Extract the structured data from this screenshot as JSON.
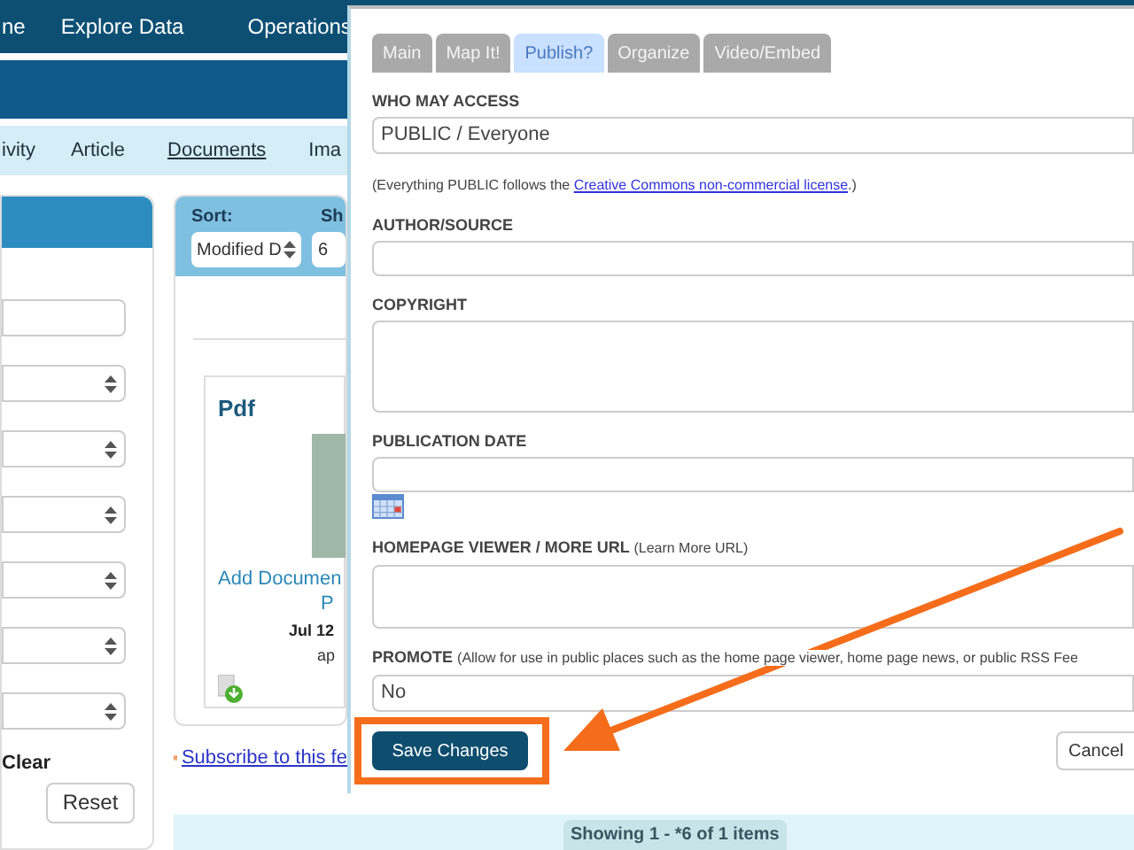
{
  "top_nav": {
    "items": [
      "ne",
      "Explore Data",
      "Operations"
    ]
  },
  "sub_nav": {
    "items": [
      {
        "label": "ivity",
        "selected": false
      },
      {
        "label": "Article",
        "selected": false
      },
      {
        "label": "Documents",
        "selected": true
      },
      {
        "label": "Ima",
        "selected": false
      }
    ]
  },
  "filter_panel": {
    "fields": [
      {
        "kind": "text"
      },
      {
        "kind": "select"
      },
      {
        "kind": "select"
      },
      {
        "kind": "select"
      },
      {
        "kind": "select"
      },
      {
        "kind": "select"
      },
      {
        "kind": "select"
      }
    ],
    "clear_label": "Clear",
    "reset_button": "Reset"
  },
  "results": {
    "sort_label": "Sort:",
    "show_label": "Sh",
    "sort_value": "Modified D",
    "show_value": "6",
    "card": {
      "title": "Pdf",
      "link": "Add Documen",
      "link_line_2": "P",
      "date": "Jul 12",
      "line_4": "ap"
    },
    "subscribe_link": "Subscribe to this fe",
    "showing": "Showing 1 - *6 of 1 items"
  },
  "dialog": {
    "tabs": [
      {
        "label": "Main",
        "selected": false
      },
      {
        "label": "Map It!",
        "selected": false
      },
      {
        "label": "Publish?",
        "selected": true
      },
      {
        "label": "Organize",
        "selected": false
      },
      {
        "label": "Video/Embed",
        "selected": false
      }
    ],
    "fields": [
      {
        "kind": "select",
        "label": "WHO MAY ACCESS",
        "value": "PUBLIC / Everyone"
      },
      {
        "kind": "note",
        "before": "(Everything PUBLIC follows the ",
        "link": "Creative Commons non-commercial license",
        "after": ".)"
      },
      {
        "kind": "text",
        "label": "AUTHOR/SOURCE"
      },
      {
        "kind": "textarea",
        "label": "COPYRIGHT"
      },
      {
        "kind": "date",
        "label": "PUBLICATION DATE"
      },
      {
        "kind": "url",
        "label": "HOMEPAGE VIEWER / MORE URL",
        "label_note": "(Learn More URL)"
      },
      {
        "kind": "select",
        "label": "PROMOTE",
        "label_note": "(Allow for use in public places such as the home page viewer, home page news, or public RSS Fee",
        "value": "No"
      }
    ],
    "save_button": "Save Changes",
    "cancel_button": "Cancel"
  }
}
